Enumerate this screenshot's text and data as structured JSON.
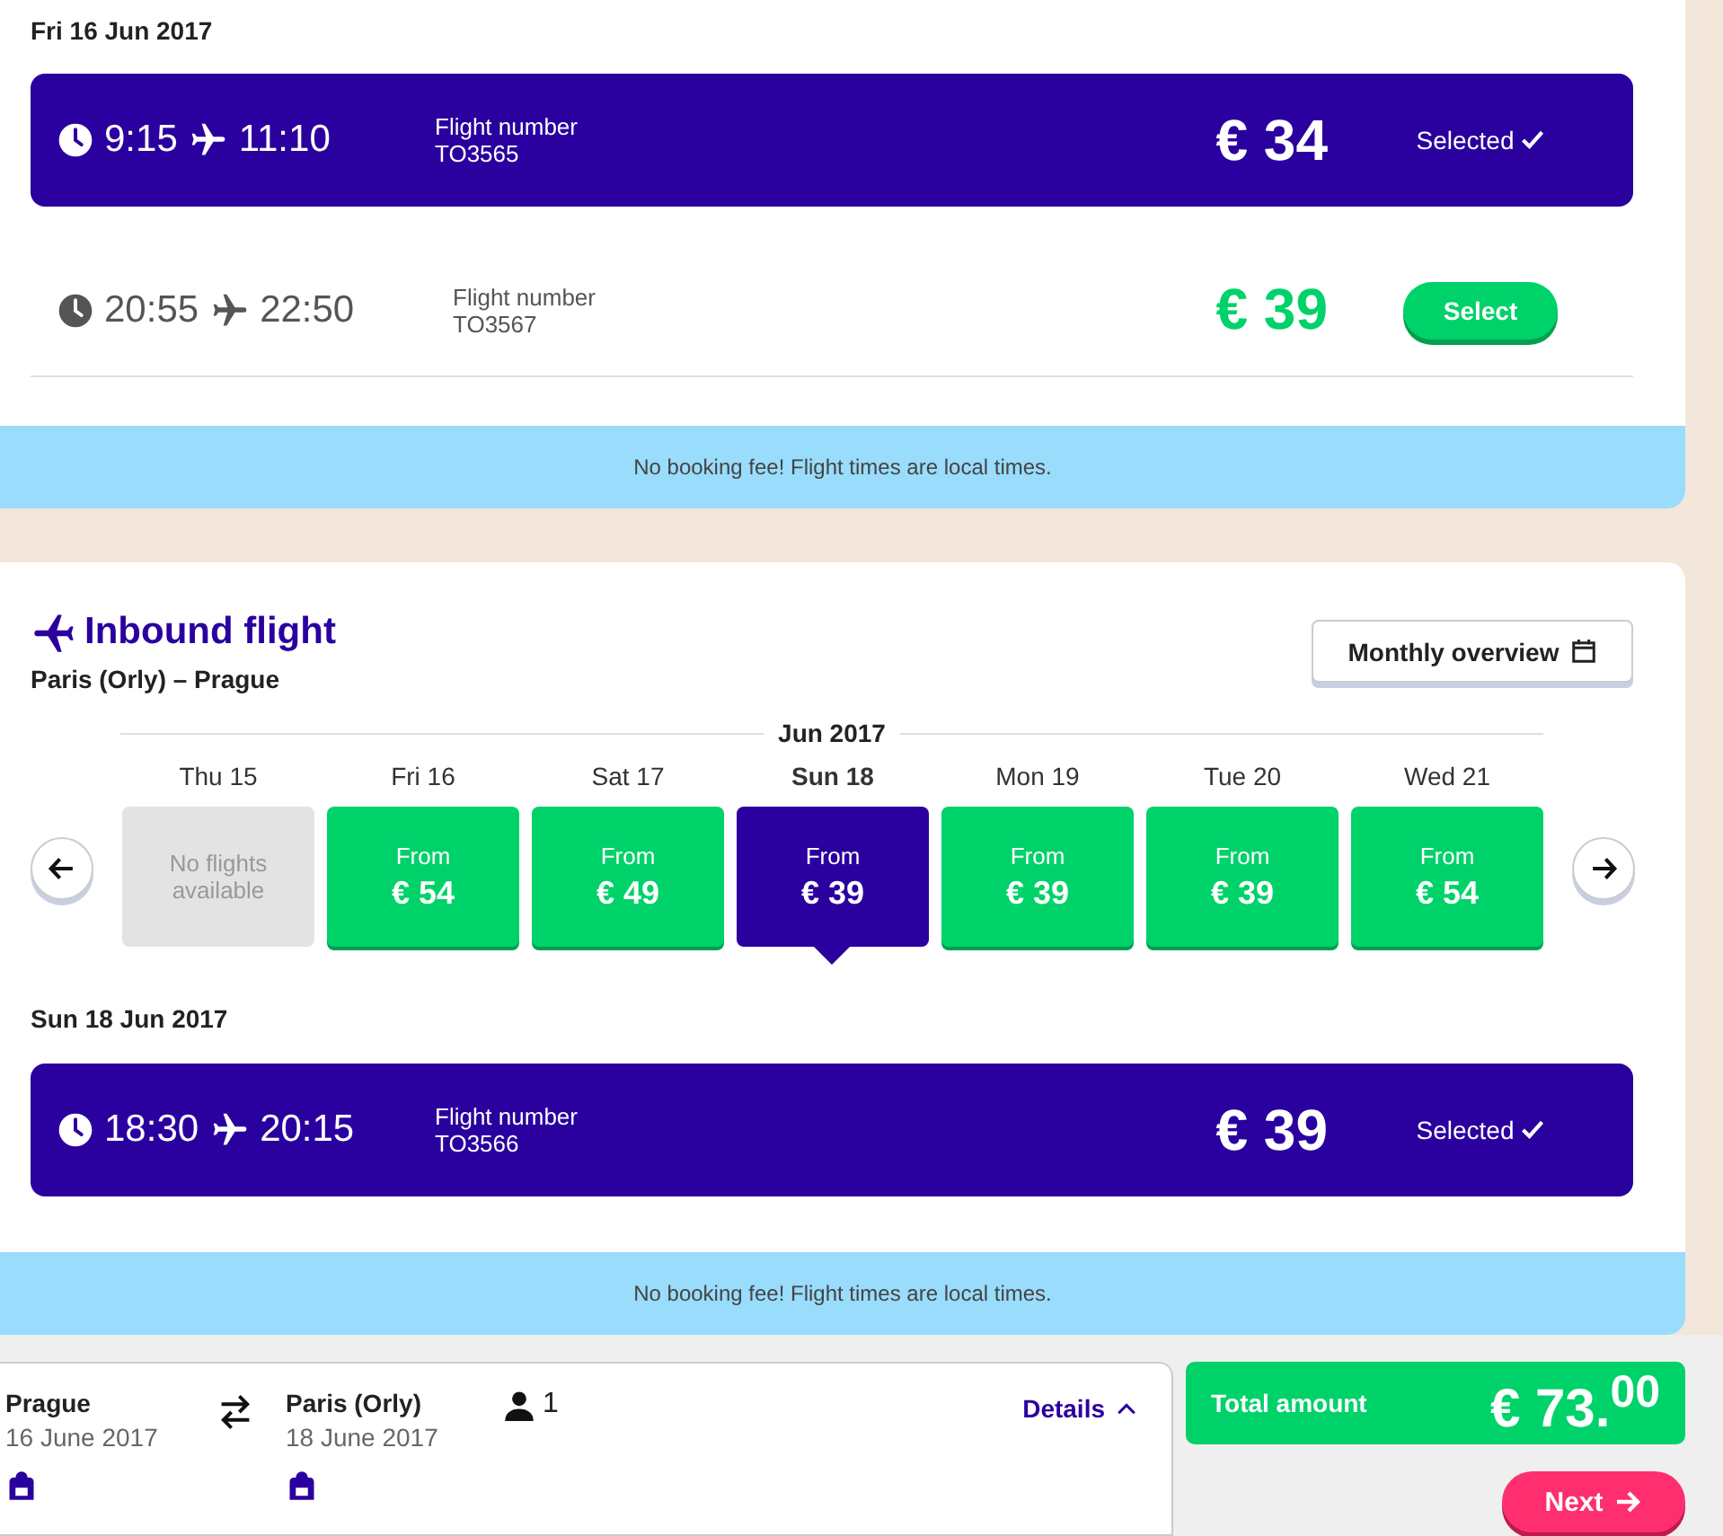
{
  "outbound": {
    "date": "Fri 16 Jun 2017",
    "flights": [
      {
        "departure": "9:15",
        "arrival": "11:10",
        "number_label": "Flight number",
        "number": "TO3565",
        "price": "€ 34",
        "selected": true,
        "action": "Selected"
      },
      {
        "departure": "20:55",
        "arrival": "22:50",
        "number_label": "Flight number",
        "number": "TO3567",
        "price": "€ 39",
        "selected": false,
        "action": "Select"
      }
    ],
    "info": "No booking fee! Flight times are local times."
  },
  "inbound": {
    "title": "Inbound flight",
    "route": "Paris (Orly) – Prague",
    "overview_button": "Monthly overview",
    "month": "Jun 2017",
    "days": [
      {
        "label": "Thu 15",
        "available": false,
        "note": "No flights available",
        "selected": false
      },
      {
        "label": "Fri 16",
        "available": true,
        "from": "From",
        "price": "€ 54",
        "selected": false
      },
      {
        "label": "Sat 17",
        "available": true,
        "from": "From",
        "price": "€ 49",
        "selected": false
      },
      {
        "label": "Sun 18",
        "available": true,
        "from": "From",
        "price": "€ 39",
        "selected": true
      },
      {
        "label": "Mon 19",
        "available": true,
        "from": "From",
        "price": "€ 39",
        "selected": false
      },
      {
        "label": "Tue 20",
        "available": true,
        "from": "From",
        "price": "€ 39",
        "selected": false
      },
      {
        "label": "Wed 21",
        "available": true,
        "from": "From",
        "price": "€ 54",
        "selected": false
      }
    ],
    "date": "Sun 18 Jun 2017",
    "flights": [
      {
        "departure": "18:30",
        "arrival": "20:15",
        "number_label": "Flight number",
        "number": "TO3566",
        "price": "€ 39",
        "selected": true,
        "action": "Selected"
      }
    ],
    "info": "No booking fee! Flight times are local times."
  },
  "summary": {
    "origin": {
      "city": "Prague",
      "date": "16 June 2017"
    },
    "destination": {
      "city": "Paris (Orly)",
      "date": "18 June 2017"
    },
    "passengers": "1",
    "details": "Details",
    "total_label": "Total amount",
    "total": "€ 73.$^{00}$",
    "next": "Next"
  }
}
